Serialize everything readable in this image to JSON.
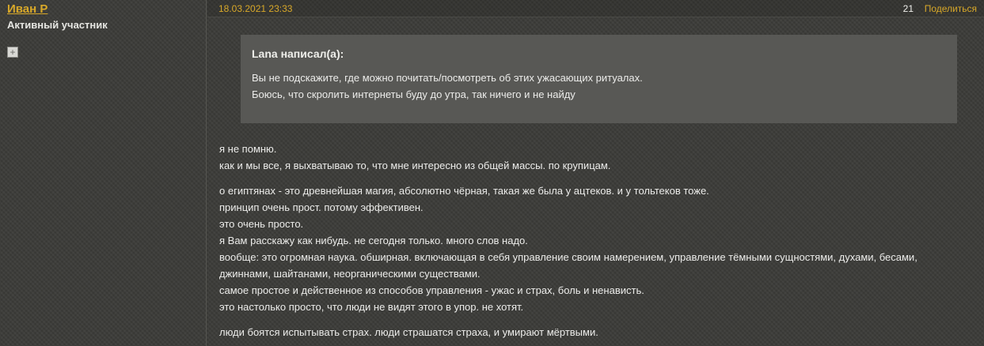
{
  "user": {
    "name": "Иван Р",
    "title": "Активный участник",
    "expand_symbol": "+"
  },
  "post": {
    "date": "18.03.2021 23:33",
    "number": "21",
    "share_label": "Поделиться"
  },
  "quote": {
    "author": "Lana написал(а):",
    "lines": [
      "Вы не подскажите, где можно почитать/посмотреть об этих ужасающих ритуалах.",
      "Боюсь, что скролить интернеты буду до утра, так ничего и не найду"
    ]
  },
  "paragraphs": [
    [
      "я не помню.",
      "как и мы все, я выхватываю то, что мне интересно из общей массы. по крупицам."
    ],
    [
      "о египтянах - это древнейшая магия, абсолютно чёрная, такая же была у ацтеков. и у тольтеков тоже.",
      "принцип очень прост. потому эффективен.",
      "это очень просто.",
      "я Вам расскажу как нибудь. не сегодня только. много слов надо.",
      "вообще: это огромная наука. обширная. включающая в себя управление своим намерением, управление тёмными сущностями, духами, бесами,",
      "джиннами, шайтанами, неорганическими существами.",
      "самое простое и действенное из способов управления - ужас и страх, боль и ненависть.",
      "это настолько просто, что люди не видят этого в упор. не хотят."
    ],
    [
      "люди боятся испытывать страх. люди страшатся страха, и умирают мёртвыми."
    ]
  ],
  "colors": {
    "accent": "#d8a829",
    "background": "#3b3b38",
    "quote_background": "#585855",
    "text": "#ececea"
  }
}
